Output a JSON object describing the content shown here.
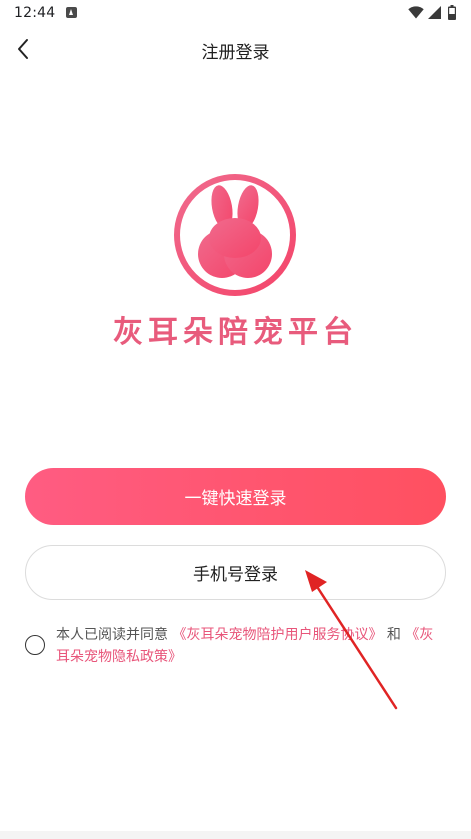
{
  "status_bar": {
    "time": "12:44",
    "icons": [
      "app-notification-icon",
      "wifi-icon",
      "signal-icon",
      "battery-icon"
    ]
  },
  "nav": {
    "back_icon": "chevron-left-icon",
    "title": "注册登录"
  },
  "logo": {
    "icon": "rabbit-logo-icon",
    "app_name": "灰耳朵陪宠平台",
    "brand_color": "#e85b7c"
  },
  "actions": {
    "quick_login_label": "一键快速登录",
    "phone_login_label": "手机号登录",
    "primary_color": "#ff5670"
  },
  "agreement": {
    "checked": false,
    "prefix": "本人已阅读并同意",
    "user_agreement": "《灰耳朵宠物陪护用户服务协议》",
    "conjunction": "和",
    "privacy_policy": "《灰耳朵宠物隐私政策》",
    "link_color": "#e8557a"
  },
  "annotation": {
    "arrow_color": "#e02424"
  }
}
